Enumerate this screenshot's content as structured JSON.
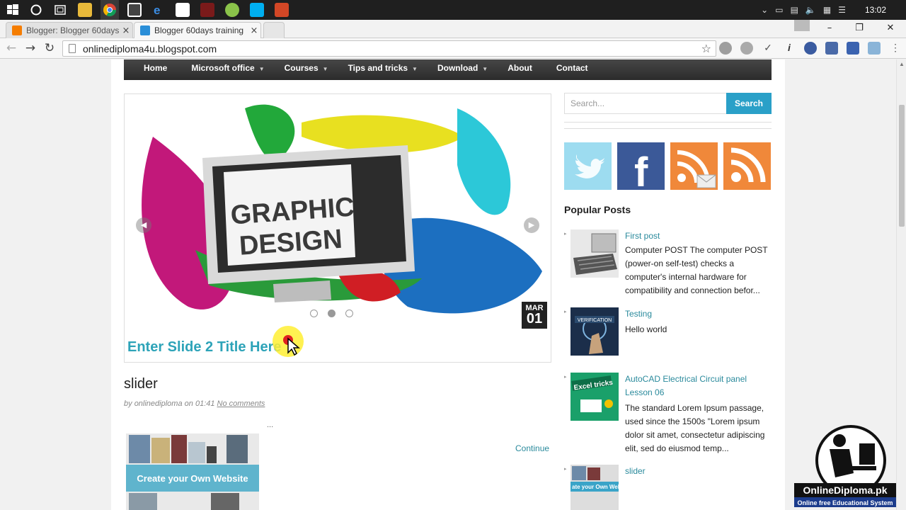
{
  "taskbar": {
    "clock": "13:02"
  },
  "browser": {
    "tabs": [
      {
        "label": "Blogger: Blogger 60days t",
        "close": "×"
      },
      {
        "label": "Blogger 60days training",
        "close": "×"
      }
    ],
    "url": "onlinediploma4u.blogspot.com"
  },
  "nav": {
    "items": [
      {
        "label": "Home",
        "caret": ""
      },
      {
        "label": "Microsoft office",
        "caret": "▼"
      },
      {
        "label": "Courses",
        "caret": "▼"
      },
      {
        "label": "Tips and tricks",
        "caret": "▼"
      },
      {
        "label": "Download",
        "caret": "▼"
      },
      {
        "label": "About",
        "caret": ""
      },
      {
        "label": "Contact",
        "caret": ""
      }
    ]
  },
  "slider": {
    "image_text_line1": "GRAPHIC",
    "image_text_line2": "DESIGN",
    "date_month": "MAR",
    "date_day": "01",
    "title": "Enter Slide 2 Title Here",
    "active_dot": 1
  },
  "post": {
    "title": "slider",
    "meta_prefix": "by",
    "author": "onlinediploma",
    "meta_on": "on",
    "time": "01:41",
    "comments": "No comments",
    "ellipsis": "...",
    "thumb_text": "Create your Own Website",
    "continue": "Continue"
  },
  "sidebar": {
    "search_placeholder": "Search...",
    "search_button": "Search",
    "popular_heading": "Popular Posts",
    "popular": [
      {
        "title": "First post",
        "desc": "Computer POST  The computer POST (power-on self-test) checks a computer's internal hardware for compatibility and connection befor..."
      },
      {
        "title": "Testing",
        "desc": "Hello world"
      },
      {
        "title": "AutoCAD Electrical Circuit panel Lesson 06",
        "desc": "The standard Lorem Ipsum passage, used since the 1500s \"Lorem ipsum dolor sit amet, consectetur adipiscing elit, sed do eiusmod temp..."
      },
      {
        "title": "slider",
        "desc": ""
      }
    ],
    "thumb_labels": {
      "verification": "VERIFICATION",
      "excel": "Excel tricks",
      "website": "ate your Own Webs"
    }
  },
  "watermark": {
    "brand": "OnlineDiploma.pk",
    "tagline": "Online free Educational System"
  },
  "colors": {
    "accent": "#2aa0c8",
    "link": "#2a8a9c",
    "slide_title": "#2da3b8"
  }
}
